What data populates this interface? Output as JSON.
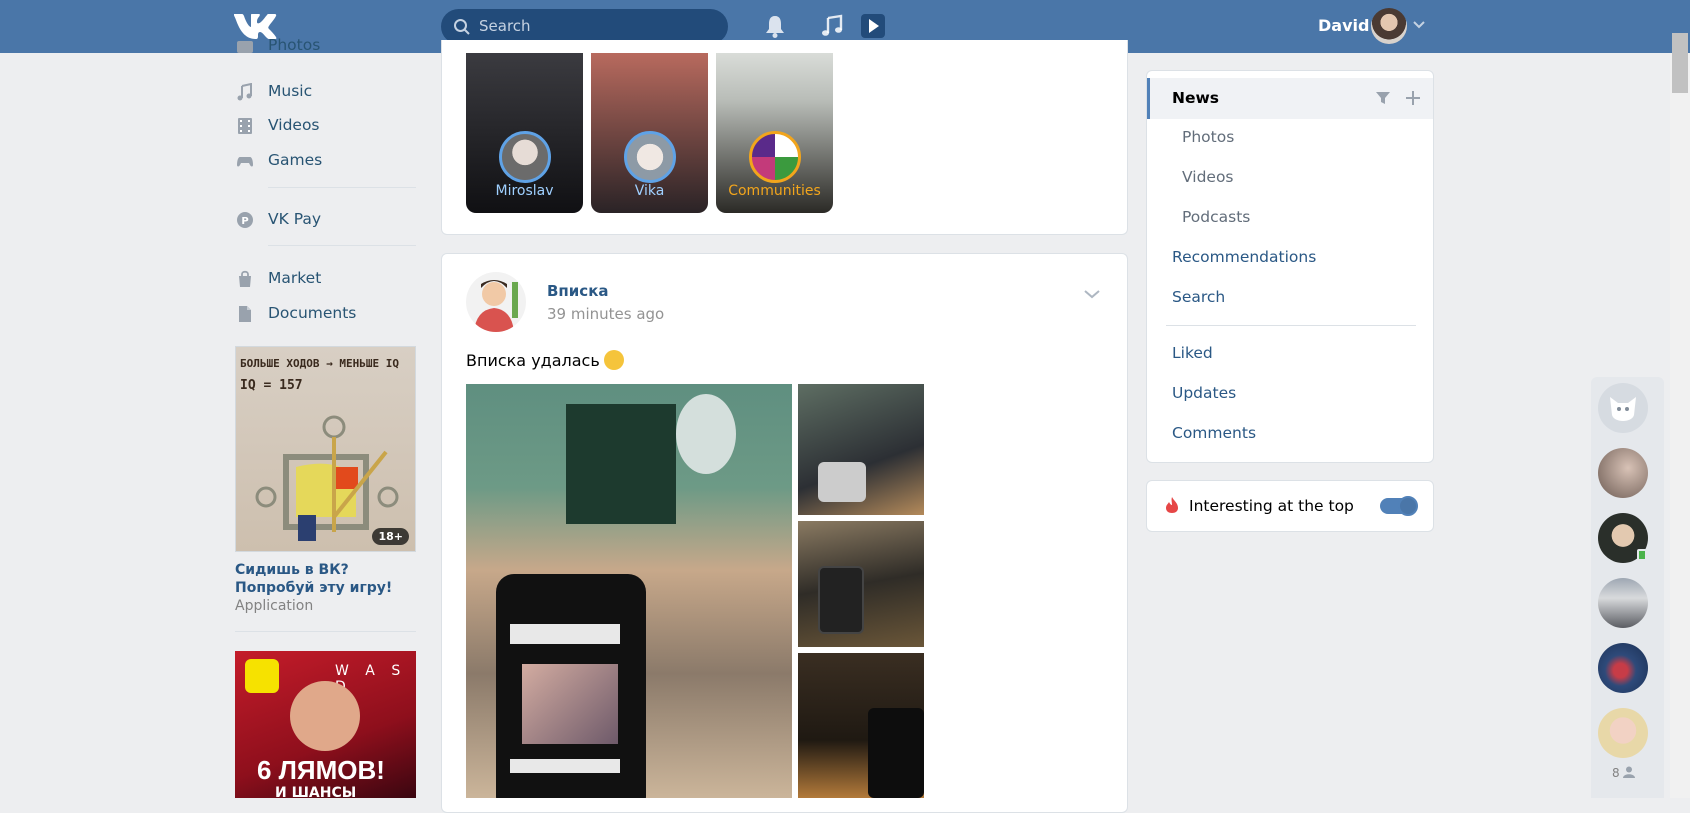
{
  "header": {
    "search_placeholder": "Search",
    "user_name": "David"
  },
  "left_nav": {
    "items": [
      {
        "label": "Photos",
        "icon": "photos-icon"
      },
      {
        "label": "Music",
        "icon": "music-icon"
      },
      {
        "label": "Videos",
        "icon": "videos-icon"
      },
      {
        "label": "Games",
        "icon": "games-icon"
      },
      {
        "label": "VK Pay",
        "icon": "vk-pay-icon"
      },
      {
        "label": "Market",
        "icon": "market-icon"
      },
      {
        "label": "Documents",
        "icon": "documents-icon"
      }
    ],
    "ad1": {
      "image_text_line1": "БОЛЬШЕ ХОДОВ → МЕНЬШЕ IQ",
      "image_text_line2": "IQ = 157",
      "age_badge": "18+",
      "title": "Сидишь в ВК? Попробуй эту игру!",
      "subtitle": "Application"
    },
    "ad2": {
      "headline": "6 ЛЯМОВ!",
      "subline": "И ШАНСЫ",
      "keys": "W A S D"
    }
  },
  "stories": [
    {
      "name": "Miroslav"
    },
    {
      "name": "Vika"
    },
    {
      "name": "Communities"
    }
  ],
  "post": {
    "author": "Вписка",
    "time": "39 minutes ago",
    "text": "Вписка удалась"
  },
  "right_menu": {
    "items": [
      {
        "label": "News",
        "active": true
      },
      {
        "label": "Photos"
      },
      {
        "label": "Videos"
      },
      {
        "label": "Podcasts"
      },
      {
        "label": "Recommendations"
      },
      {
        "label": "Search"
      },
      {
        "label": "Liked"
      },
      {
        "label": "Updates"
      },
      {
        "label": "Comments"
      }
    ],
    "interesting_label": "Interesting at the top",
    "interesting_on": true
  },
  "chat": {
    "online_count": "8"
  },
  "colors": {
    "header": "#4a76a8",
    "link": "#2a5885",
    "background": "#edeef0",
    "accent": "#5181b8"
  }
}
